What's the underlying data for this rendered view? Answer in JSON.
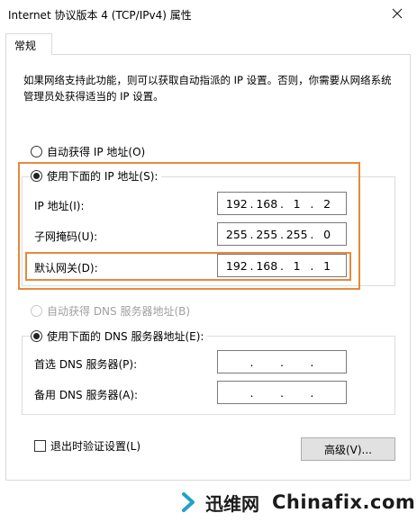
{
  "window": {
    "title": "Internet 协议版本 4 (TCP/IPv4) 属性"
  },
  "tabs": [
    {
      "label": "常规"
    }
  ],
  "description": "如果网络支持此功能，则可以获取自动指派的 IP 设置。否则，你需要从网络系统管理员处获得适当的 IP 设置。",
  "ip_section": {
    "auto_label": "自动获得 IP 地址(O)",
    "manual_label": "使用下面的 IP 地址(S):",
    "selected": "manual",
    "fields": [
      {
        "label": "IP 地址(I):",
        "octets": [
          "192",
          "168",
          "1",
          "2"
        ]
      },
      {
        "label": "子网掩码(U):",
        "octets": [
          "255",
          "255",
          "255",
          "0"
        ]
      },
      {
        "label": "默认网关(D):",
        "octets": [
          "192",
          "168",
          "1",
          "1"
        ]
      }
    ]
  },
  "dns_section": {
    "auto_label": "自动获得 DNS 服务器地址(B)",
    "manual_label": "使用下面的 DNS 服务器地址(E):",
    "selected": "manual",
    "fields": [
      {
        "label": "首选 DNS 服务器(P):",
        "octets": [
          "",
          "",
          "",
          ""
        ]
      },
      {
        "label": "备用 DNS 服务器(A):",
        "octets": [
          "",
          "",
          "",
          ""
        ]
      }
    ]
  },
  "validate_checkbox": {
    "label": "退出时验证设置(L)",
    "checked": false
  },
  "advanced_button": {
    "label": "高级(V)..."
  },
  "watermark": {
    "cn": "迅维网",
    "en": "Chinafix.com"
  },
  "colors": {
    "highlight": "#e8883a"
  }
}
